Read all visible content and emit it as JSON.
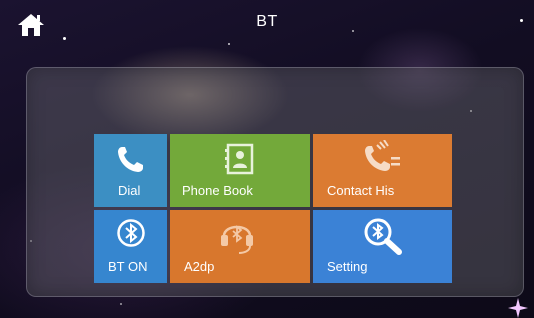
{
  "header": {
    "title": "BT",
    "home_icon": "home-icon"
  },
  "tiles": {
    "dial": {
      "label": "Dial",
      "icon": "phone-handset-icon",
      "color": "#3c8fc3"
    },
    "phone_book": {
      "label": "Phone Book",
      "icon": "contact-book-icon",
      "color": "#73a93a"
    },
    "contact_history": {
      "label": "Contact His",
      "icon": "call-log-icon",
      "color": "#db7b32"
    },
    "bt_on": {
      "label": "BT ON",
      "icon": "bluetooth-icon",
      "color": "#3686cf"
    },
    "a2dp": {
      "label": "A2dp",
      "icon": "bluetooth-headset-icon",
      "color": "#d8772d"
    },
    "setting": {
      "label": "Setting",
      "icon": "bluetooth-search-icon",
      "color": "#3b82d6"
    }
  }
}
